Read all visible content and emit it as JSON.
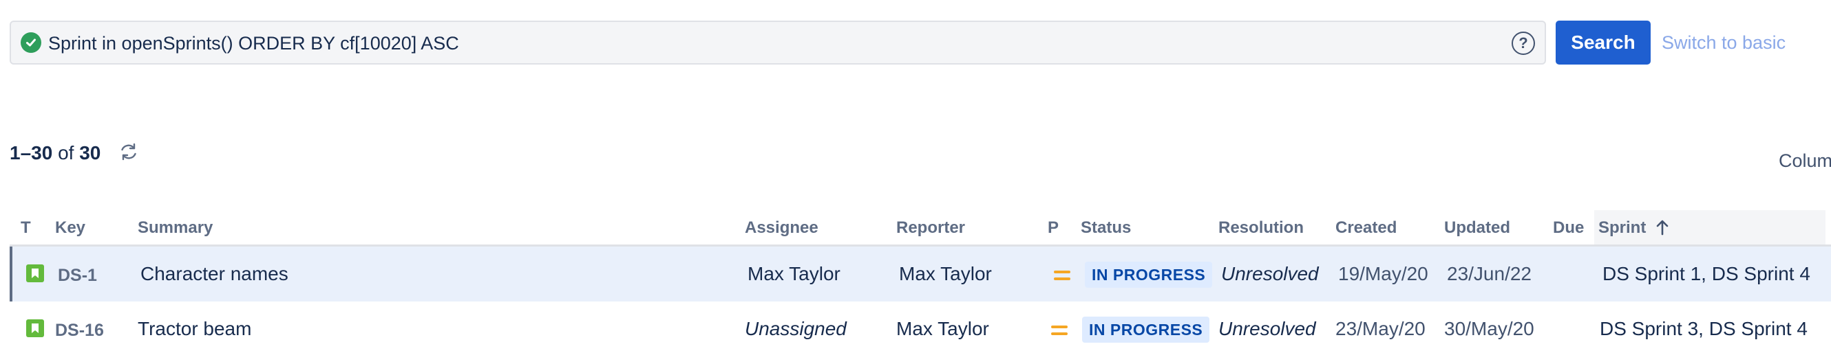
{
  "search": {
    "query": "Sprint in openSprints() ORDER BY cf[10020] ASC",
    "button_label": "Search",
    "switch_label": "Switch to basic",
    "help_glyph": "?"
  },
  "results": {
    "range": "1–30",
    "of_label": "of",
    "total": "30",
    "columns_label": "Colum"
  },
  "table": {
    "headers": [
      "T",
      "Key",
      "Summary",
      "Assignee",
      "Reporter",
      "P",
      "Status",
      "Resolution",
      "Created",
      "Updated",
      "Due",
      "Sprint"
    ],
    "sort_column": "Sprint",
    "sort_direction": "ascending",
    "rows": [
      {
        "type_icon": "story-icon",
        "key": "DS-1",
        "summary": "Character names",
        "assignee": "Max Taylor",
        "reporter": "Max Taylor",
        "priority_icon": "medium-priority-icon",
        "status": "IN PROGRESS",
        "resolution": "Unresolved",
        "created": "19/May/20",
        "updated": "23/Jun/22",
        "due": "",
        "sprint": "DS Sprint 1, DS Sprint 4"
      },
      {
        "type_icon": "story-icon",
        "key": "DS-16",
        "summary": "Tractor beam",
        "assignee": "Unassigned",
        "reporter": "Max Taylor",
        "priority_icon": "medium-priority-icon",
        "status": "IN PROGRESS",
        "resolution": "Unresolved",
        "created": "23/May/20",
        "updated": "30/May/20",
        "due": "",
        "sprint": "DS Sprint 3, DS Sprint 4"
      }
    ]
  },
  "colors": {
    "primary_button": "#1f5fd0",
    "valid_query": "#2e9e5b",
    "story_icon": "#63ba3c",
    "priority_medium": "#f5a623",
    "status_bg": "#deebff",
    "status_text": "#0747a6",
    "selected_row": "#e9f0fb"
  }
}
